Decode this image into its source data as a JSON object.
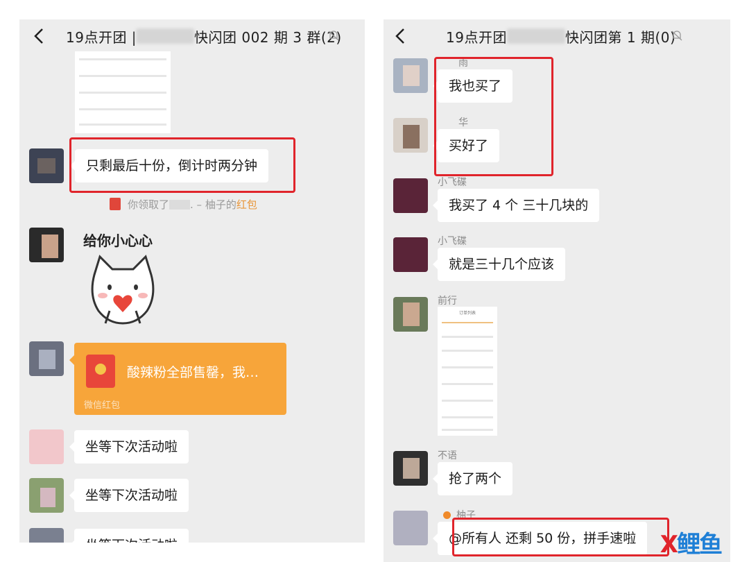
{
  "left_chat": {
    "title_prefix": "19点开团 |",
    "title_suffix": "快闪团 002 期 3 群(2)",
    "messages": [
      {
        "text": "只剩最后十份，倒计时两分钟"
      },
      {
        "system_prefix": "你领取了",
        "system_mid": ". – 柚子的",
        "system_link": "红包"
      },
      {
        "sticker_caption": "给你小心心"
      },
      {
        "redpacket_text": "酸辣粉全部售罄，我…",
        "redpacket_footer": "微信红包"
      },
      {
        "text": "坐等下次活动啦"
      },
      {
        "text": "坐等下次活动啦"
      },
      {
        "text": "坐等下次活动啦"
      }
    ]
  },
  "right_chat": {
    "title_prefix": "19点开团",
    "title_suffix": "快闪团第 1 期(0)",
    "messages": [
      {
        "sender": "雨",
        "text": "我也买了"
      },
      {
        "sender": "华",
        "text": "买好了"
      },
      {
        "sender": "小飞碟",
        "text": "我买了 4 个  三十几块的"
      },
      {
        "sender": "小飞碟",
        "text": "就是三十几个应该"
      },
      {
        "sender": "前行",
        "thumb_title": "订单列表"
      },
      {
        "sender": "不语",
        "text": "抢了两个"
      },
      {
        "sender": "柚子",
        "text": "@所有人  还剩 50 份，拼手速啦"
      }
    ]
  },
  "watermark": {
    "text": "鲤鱼",
    "prefix": "X",
    "colors": [
      "#e0242b",
      "#1e7fd6"
    ]
  },
  "colors": {
    "accent_red": "#e0242b",
    "redpacket": "#f7a53a",
    "bubble": "#ffffff",
    "background": "#ededed"
  }
}
